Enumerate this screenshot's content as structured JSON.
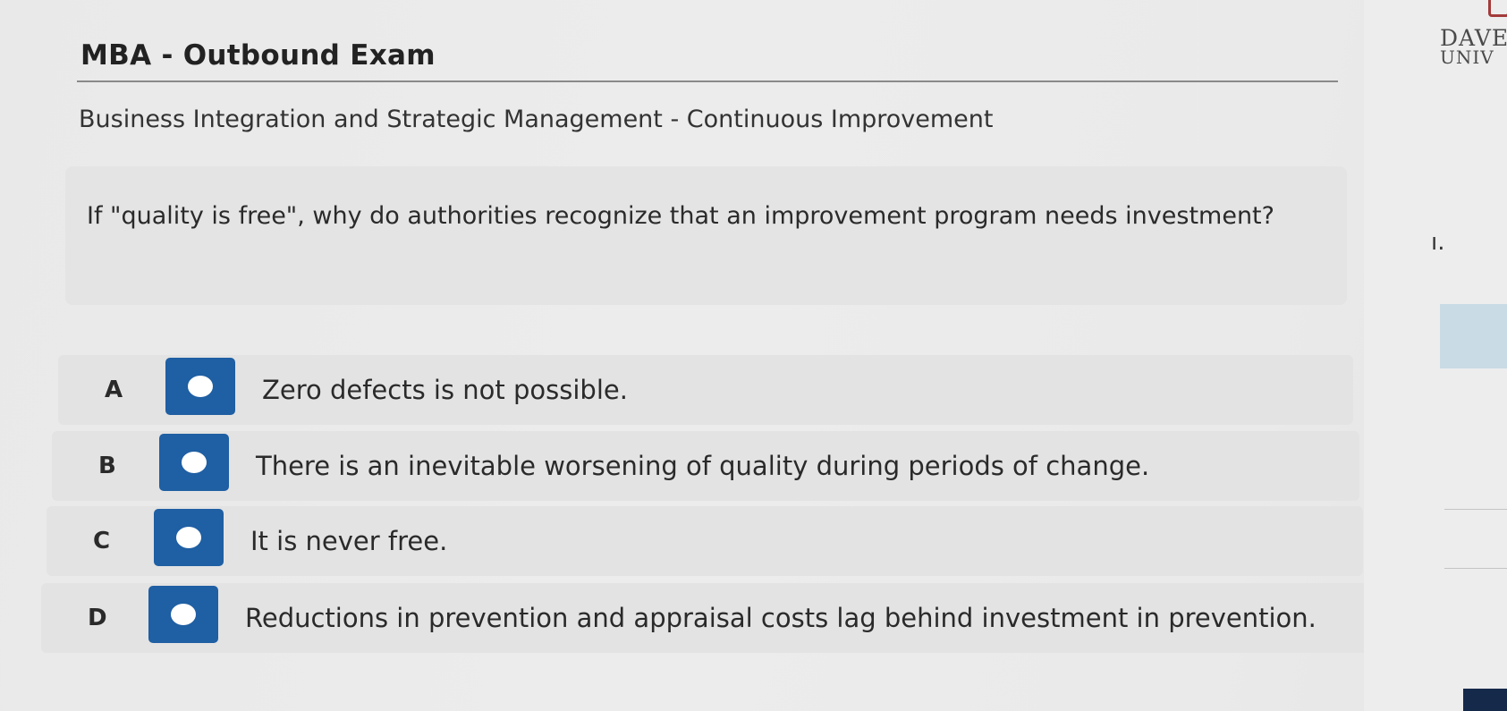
{
  "exam": {
    "title": "MBA - Outbound Exam",
    "section": "Business Integration and Strategic Management - Continuous Improvement"
  },
  "question": {
    "text": "If \"quality is free\", why do authorities recognize that an improvement program needs investment?"
  },
  "options": [
    {
      "letter": "A",
      "text": "Zero defects is not possible."
    },
    {
      "letter": "B",
      "text": "There is an inevitable worsening of quality during periods of change."
    },
    {
      "letter": "C",
      "text": "It is never free."
    },
    {
      "letter": "D",
      "text": "Reductions in prevention and appraisal costs lag behind investment in prevention."
    }
  ],
  "side": {
    "logo_line1": "DAVE",
    "logo_line2": "UNIV",
    "text_fragment": "ı."
  },
  "colors": {
    "radio_button": "#1f5fa3",
    "radio_dot": "#ffffff",
    "card_background": "#e3e3e3"
  },
  "icons": {
    "radio": "radio-unselected-icon"
  }
}
